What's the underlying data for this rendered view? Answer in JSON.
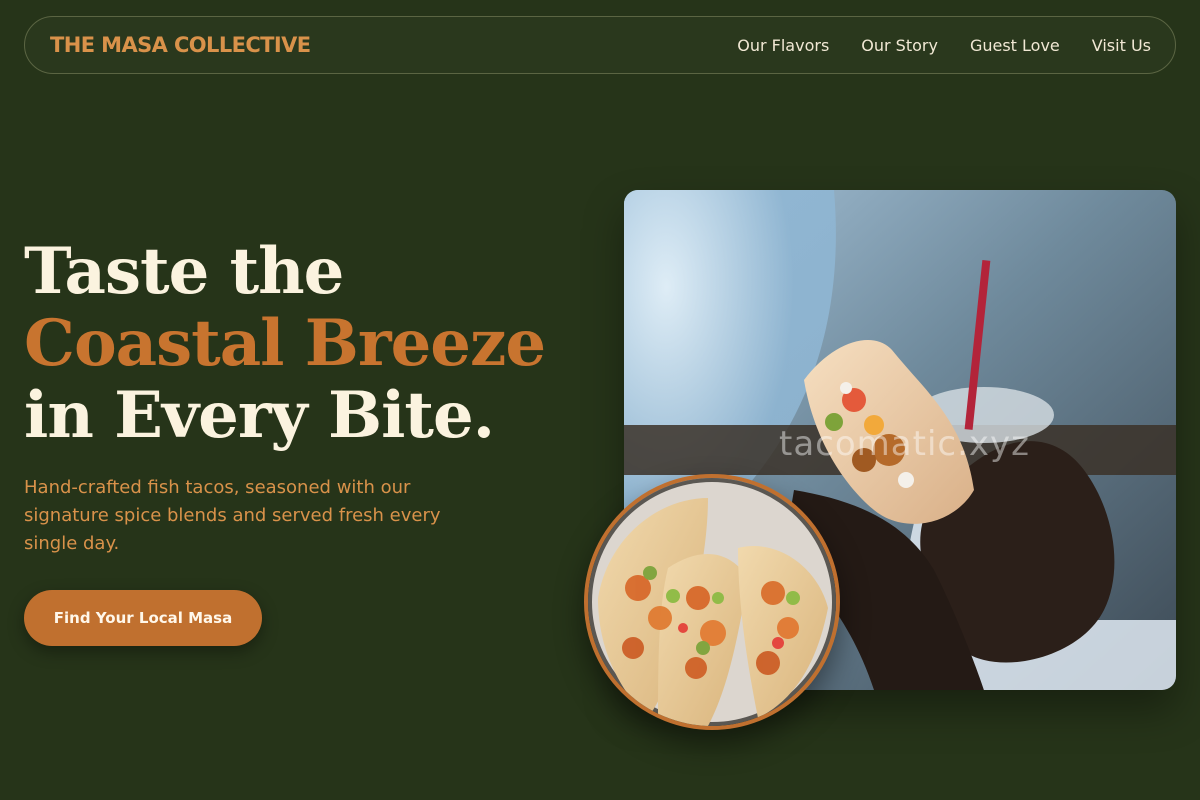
{
  "brand": {
    "name": "THE MASA COLLECTIVE"
  },
  "nav": {
    "links": [
      {
        "label": "Our Flavors"
      },
      {
        "label": "Our Story"
      },
      {
        "label": "Guest Love"
      },
      {
        "label": "Visit Us"
      }
    ]
  },
  "hero": {
    "headline_line1": "Taste the",
    "headline_line2": "Coastal Breeze",
    "headline_line3": "in Every Bite.",
    "subtext": "Hand-crafted fish tacos, seasoned with our signature spice blends and served fresh every single day.",
    "cta_label": "Find Your Local Masa"
  },
  "images": {
    "main_watermark": "tacomatic.xyz"
  },
  "colors": {
    "background": "#263419",
    "accent": "#c8742f",
    "cream": "#fbf3df",
    "brand": "#d9924a"
  }
}
